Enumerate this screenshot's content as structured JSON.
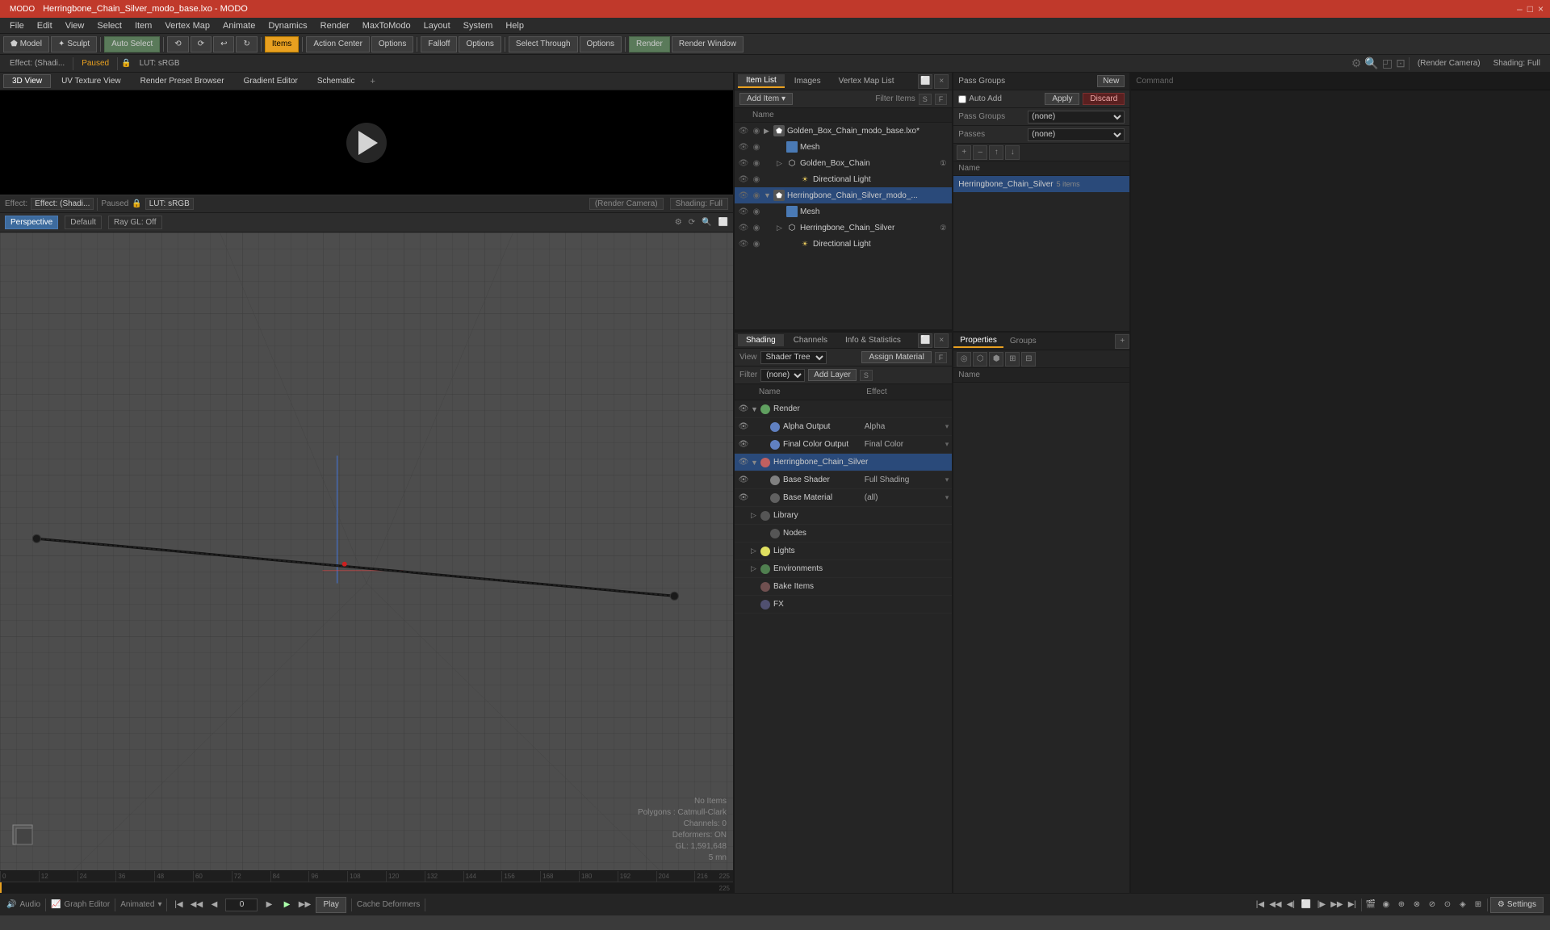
{
  "window": {
    "title": "Herringbone_Chain_Silver_modo_base.lxo - MODO",
    "controls": [
      "–",
      "□",
      "×"
    ]
  },
  "menu": {
    "items": [
      "File",
      "Edit",
      "View",
      "Select",
      "Item",
      "Vertex Map",
      "Animate",
      "Dynamics",
      "Render",
      "MaxToModo",
      "Layout",
      "System",
      "Help"
    ]
  },
  "toolbar1": {
    "mode_btns": [
      "Model",
      "Sculpt"
    ],
    "auto_select": "Auto Select",
    "action_tools": [
      "",
      "",
      "",
      "",
      ""
    ],
    "items_btn": "Items",
    "action_center": "Action Center",
    "options1": "Options",
    "falloff": "Falloff",
    "options2": "Options",
    "select_through": "Select Through",
    "options3": "Options",
    "render": "Render",
    "render_window": "Render Window"
  },
  "toolbar2": {
    "effect_label": "Effect: (Shadi...",
    "paused": "Paused",
    "lut": "LUT: sRGB",
    "render_camera": "(Render Camera)",
    "shading": "Shading: Full"
  },
  "viewport_tabs": {
    "tabs": [
      "3D View",
      "UV Texture View",
      "Render Preset Browser",
      "Gradient Editor",
      "Schematic"
    ],
    "add": "+"
  },
  "viewport3d": {
    "perspective": "Perspective",
    "default": "Default",
    "ray_gl": "Ray GL: Off",
    "stats": {
      "no_items": "No Items",
      "polygons": "Polygons : Catmull-Clark",
      "channels": "Channels: 0",
      "deformers": "Deformers: ON",
      "gl": "GL: 1,591,648",
      "time": "5 mn"
    }
  },
  "item_list": {
    "tabs": [
      "Item List",
      "Images",
      "Vertex Map List"
    ],
    "add_item": "Add Item",
    "filter_label": "Filter Items",
    "s_btn": "S",
    "f_btn": "F",
    "col_header": "Name",
    "items": [
      {
        "id": 1,
        "level": 0,
        "icon": "scene",
        "name": "Golden_Box_Chain_modo_base.lxo*",
        "expanded": true
      },
      {
        "id": 2,
        "level": 1,
        "icon": "mesh",
        "name": "Mesh",
        "expanded": false
      },
      {
        "id": 3,
        "level": 1,
        "icon": "group",
        "name": "Golden_Box_Chain",
        "badge": "1",
        "expanded": false
      },
      {
        "id": 4,
        "level": 2,
        "icon": "light",
        "name": "Directional Light",
        "expanded": false
      },
      {
        "id": 5,
        "level": 0,
        "icon": "scene",
        "name": "Herringbone_Chain_Silver_modo_...",
        "expanded": true,
        "selected": true
      },
      {
        "id": 6,
        "level": 1,
        "icon": "mesh",
        "name": "Mesh",
        "expanded": false
      },
      {
        "id": 7,
        "level": 1,
        "icon": "group",
        "name": "Herringbone_Chain_Silver",
        "badge": "2",
        "expanded": false
      },
      {
        "id": 8,
        "level": 2,
        "icon": "light",
        "name": "Directional Light",
        "expanded": false
      }
    ]
  },
  "groups": {
    "header": "Pass Groups",
    "new_btn": "New",
    "col_header": "Name",
    "entries": [
      {
        "id": 1,
        "name": "Herringbone_Chain_Silver",
        "count": "5 items",
        "selected": true
      }
    ],
    "pass_groups_label": "Pass Groups",
    "passes_label": "Passes",
    "pass_select": "(none)",
    "passes_select": "(none)",
    "auto_add": "Auto Add",
    "apply": "Apply",
    "discard": "Discard"
  },
  "shading": {
    "tabs": [
      "Shading",
      "Channels",
      "Info & Statistics"
    ],
    "view_label": "View",
    "view_select": "Shader Tree",
    "assign_material": "Assign Material",
    "f_btn": "F",
    "filter_label": "Filter",
    "filter_select": "(none)",
    "add_layer": "Add Layer",
    "s_btn": "S",
    "col_name": "Name",
    "col_effect": "Effect",
    "rows": [
      {
        "id": 1,
        "level": 0,
        "icon": "render",
        "name": "Render",
        "effect": "",
        "has_arrow": true,
        "expanded": true,
        "eye": true
      },
      {
        "id": 2,
        "level": 1,
        "icon": "output",
        "name": "Alpha Output",
        "effect": "Alpha",
        "has_dropdown": true,
        "eye": true
      },
      {
        "id": 3,
        "level": 1,
        "icon": "output2",
        "name": "Final Color Output",
        "effect": "Final Color",
        "has_dropdown": true,
        "eye": true
      },
      {
        "id": 4,
        "level": 0,
        "icon": "material",
        "name": "Herringbone_Chain_Silver",
        "effect": "",
        "has_arrow": true,
        "expanded": true,
        "eye": true,
        "selected": true
      },
      {
        "id": 5,
        "level": 1,
        "icon": "shader",
        "name": "Base Shader",
        "effect": "Full Shading",
        "has_dropdown": true,
        "eye": true
      },
      {
        "id": 6,
        "level": 1,
        "icon": "base",
        "name": "Base Material",
        "effect": "(all)",
        "has_dropdown": true,
        "eye": true
      },
      {
        "id": 7,
        "level": 0,
        "icon": "folder",
        "name": "Library",
        "has_arrow": false,
        "eye": true
      },
      {
        "id": 8,
        "level": 1,
        "icon": "folder",
        "name": "Nodes",
        "eye": true
      },
      {
        "id": 9,
        "level": 0,
        "icon": "light",
        "name": "Lights",
        "has_arrow": true,
        "eye": true
      },
      {
        "id": 10,
        "level": 0,
        "icon": "folder",
        "name": "Environments",
        "has_arrow": true,
        "eye": true
      },
      {
        "id": 11,
        "level": 0,
        "icon": "folder2",
        "name": "Bake Items",
        "eye": true
      },
      {
        "id": 12,
        "level": 0,
        "icon": "fx",
        "name": "FX",
        "eye": true
      }
    ]
  },
  "properties": {
    "tabs": [
      "Properties",
      "Groups"
    ],
    "col_header": "Name",
    "group_name": "Herringbone_Chain_Silver",
    "group_count": "5 items"
  },
  "statusbar": {
    "audio": "Audio",
    "graph_editor": "Graph Editor",
    "animated": "Animated",
    "time_val": "0",
    "play": "Play",
    "cache_deformers": "Cache Deformers",
    "settings": "Settings"
  },
  "timeline": {
    "ticks": [
      "0",
      "12",
      "24",
      "36",
      "48",
      "60",
      "72",
      "84",
      "96",
      "108",
      "120",
      "132",
      "144",
      "156",
      "168",
      "180",
      "192",
      "204",
      "216"
    ],
    "end_marker": "225",
    "current": "0",
    "end2": "225"
  }
}
